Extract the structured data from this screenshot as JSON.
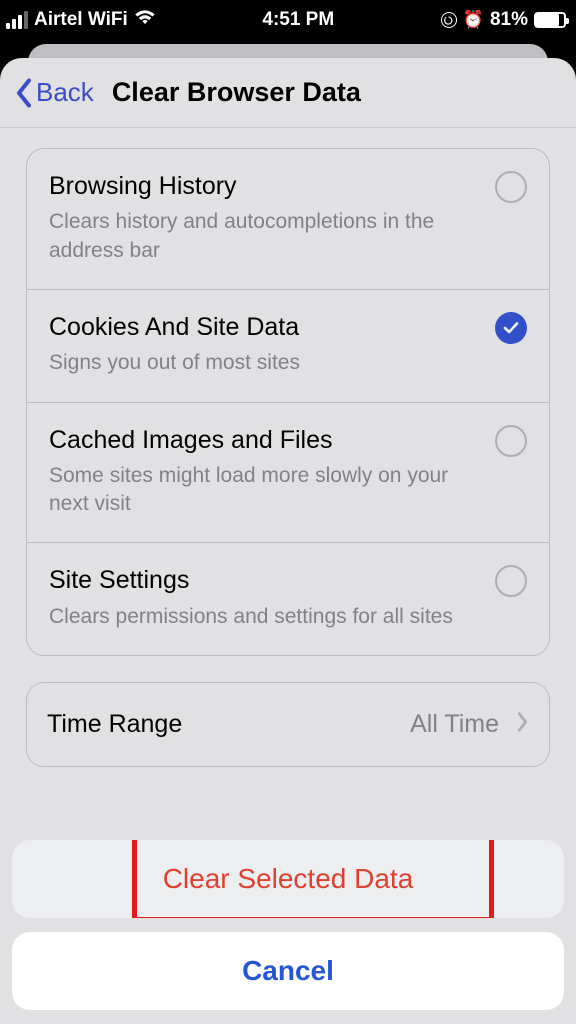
{
  "status": {
    "carrier": "Airtel WiFi",
    "time": "4:51 PM",
    "battery_pct": "81%"
  },
  "nav": {
    "back": "Back",
    "title": "Clear Browser Data"
  },
  "options": [
    {
      "title": "Browsing History",
      "desc": "Clears history and autocompletions in the address bar",
      "selected": false
    },
    {
      "title": "Cookies And Site Data",
      "desc": "Signs you out of most sites",
      "selected": true
    },
    {
      "title": "Cached Images and Files",
      "desc": "Some sites might load more slowly on your next visit",
      "selected": false
    },
    {
      "title": "Site Settings",
      "desc": "Clears permissions and settings for all sites",
      "selected": false
    }
  ],
  "range": {
    "label": "Time Range",
    "value": "All Time"
  },
  "sheet": {
    "clear": "Clear Selected Data",
    "cancel": "Cancel"
  }
}
